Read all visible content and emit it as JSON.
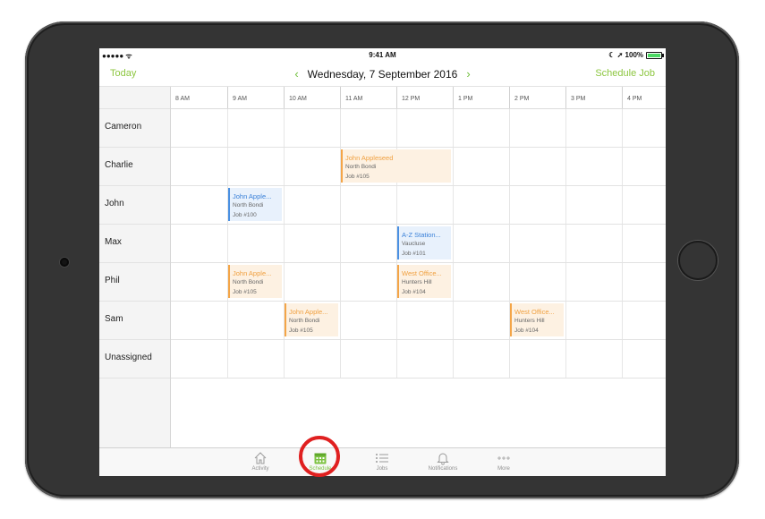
{
  "status_bar": {
    "signal": "●●●●● ᯤ",
    "time": "9:41 AM",
    "right": "☾ ➚ 100%",
    "battery_level": 1.0
  },
  "nav": {
    "today_label": "Today",
    "prev_icon": "chevron-left-icon",
    "date": "Wednesday, 7 September 2016",
    "next_icon": "chevron-right-icon",
    "schedule_job_label": "Schedule Job"
  },
  "time_slots": [
    "8 AM",
    "9 AM",
    "10 AM",
    "11 AM",
    "12 PM",
    "1 PM",
    "2 PM",
    "3 PM",
    "4 PM"
  ],
  "staff": [
    "Cameron",
    "Charlie",
    "John",
    "Max",
    "Phil",
    "Sam",
    "Unassigned"
  ],
  "jobs": [
    {
      "row": 1,
      "slot": 3,
      "span": 2,
      "title": "John Appleseed",
      "suburb": "North Bondi",
      "number": "Job #105",
      "color": "orange"
    },
    {
      "row": 2,
      "slot": 1,
      "span": 1,
      "title": "John Apple...",
      "suburb": "North Bondi",
      "number": "Job #100",
      "color": "blue"
    },
    {
      "row": 3,
      "slot": 4,
      "span": 1,
      "title": "A-Z Station...",
      "suburb": "Vaucluse",
      "number": "Job #101",
      "color": "blue"
    },
    {
      "row": 4,
      "slot": 1,
      "span": 1,
      "title": "John Apple...",
      "suburb": "North Bondi",
      "number": "Job #105",
      "color": "orange"
    },
    {
      "row": 4,
      "slot": 4,
      "span": 1,
      "title": "West Office...",
      "suburb": "Hunters Hill",
      "number": "Job #104",
      "color": "orange"
    },
    {
      "row": 5,
      "slot": 2,
      "span": 1,
      "title": "John Apple...",
      "suburb": "North Bondi",
      "number": "Job #105",
      "color": "orange"
    },
    {
      "row": 5,
      "slot": 6,
      "span": 1,
      "title": "West Office...",
      "suburb": "Hunters Hill",
      "number": "Job #104",
      "color": "orange"
    }
  ],
  "tabs": [
    {
      "key": "activity",
      "label": "Activity",
      "icon": "home-icon",
      "active": false
    },
    {
      "key": "schedule",
      "label": "Schedule",
      "icon": "calendar-icon",
      "active": true
    },
    {
      "key": "jobs",
      "label": "Jobs",
      "icon": "list-icon",
      "active": false
    },
    {
      "key": "notifications",
      "label": "Notifications",
      "icon": "bell-icon",
      "active": false
    },
    {
      "key": "more",
      "label": "More",
      "icon": "more-icon",
      "active": false
    }
  ],
  "colors": {
    "accent": "#8cc63f",
    "job_orange": "#f4a547",
    "job_blue": "#4a90e2",
    "highlight": "#e02020"
  }
}
